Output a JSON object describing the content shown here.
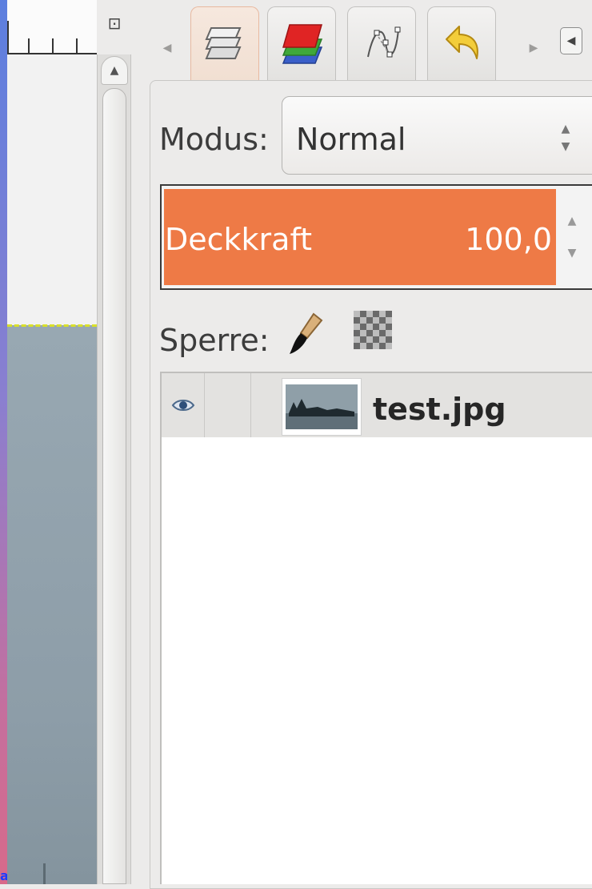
{
  "layers_dialog": {
    "mode_label": "Modus:",
    "mode_value": "Normal",
    "opacity_label": "Deckkraft",
    "opacity_value": "100,0",
    "lock_label": "Sperre:",
    "layers": [
      {
        "name": "test.jpg",
        "visible": true
      }
    ]
  },
  "dock_tabs": [
    {
      "name": "layers",
      "icon": "layers-icon",
      "active": true
    },
    {
      "name": "channels",
      "icon": "channels-icon",
      "active": false
    },
    {
      "name": "paths",
      "icon": "paths-icon",
      "active": false
    },
    {
      "name": "undo-history",
      "icon": "undo-icon",
      "active": false
    }
  ],
  "icons": {
    "tabs_left": "chevron-left-icon",
    "tabs_right": "chevron-right-icon",
    "dock_menu": "dock-menu-icon",
    "zoom": "zoom-icon",
    "eye": "eye-icon",
    "lock_pixels": "paintbrush-icon",
    "lock_alpha": "checkerboard-icon"
  },
  "colors": {
    "accent_opacity": "#ee7a46",
    "active_tab": "#f4e3d8",
    "canvas": "#8f9fa9"
  }
}
